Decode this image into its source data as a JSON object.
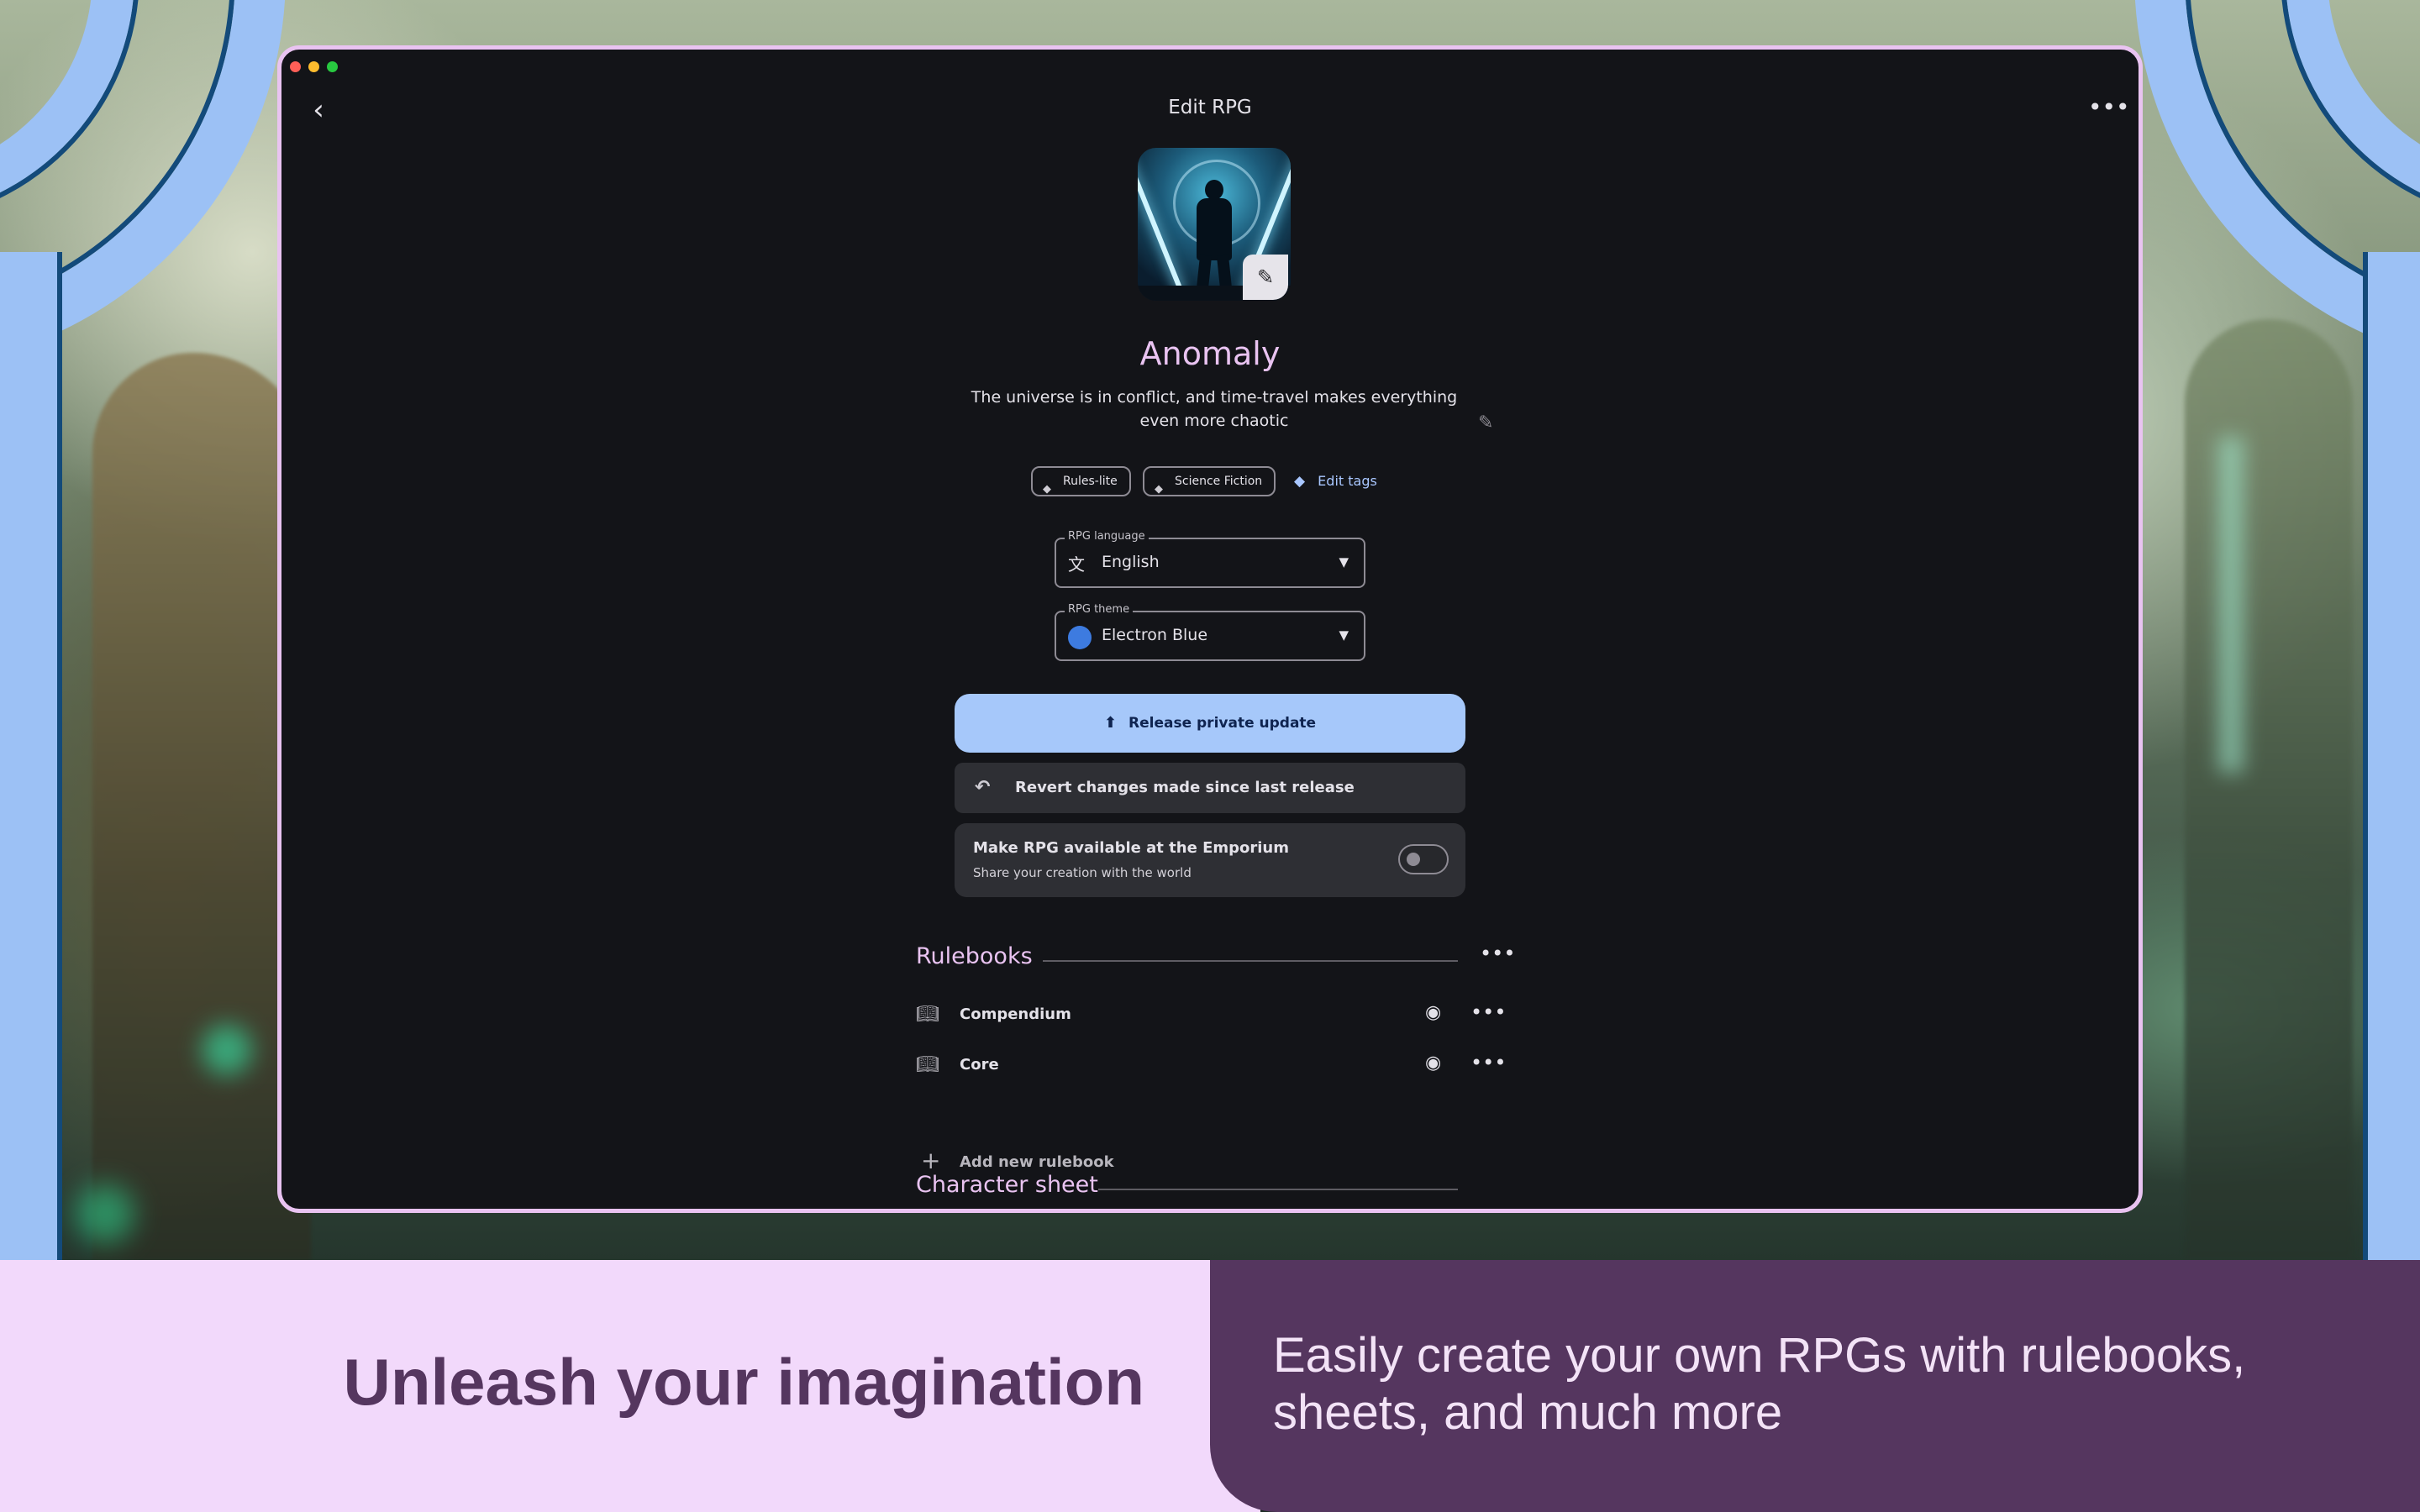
{
  "window": {
    "title": "Edit RPG",
    "back_icon": "‹",
    "more_icon": "•••"
  },
  "rpg": {
    "name": "Anomaly",
    "description": "The universe is in conflict, and time-travel makes everything even more chaotic",
    "tags": [
      "Rules-lite",
      "Science Fiction"
    ],
    "edit_tags_label": "Edit tags"
  },
  "language": {
    "label": "RPG language",
    "value": "English"
  },
  "theme": {
    "label": "RPG theme",
    "value": "Electron Blue",
    "color": "#3d7be0"
  },
  "actions": {
    "release_label": "Release private update",
    "revert_label": "Revert changes made since last release",
    "emporium_title": "Make RPG available at the Emporium",
    "emporium_subtitle": "Share your creation with the world",
    "emporium_enabled": false
  },
  "rulebooks": {
    "section_title": "Rulebooks",
    "items": [
      {
        "name": "Compendium"
      },
      {
        "name": "Core"
      }
    ],
    "add_label": "Add new rulebook"
  },
  "character_sheet": {
    "section_title": "Character sheet"
  },
  "banner": {
    "headline": "Unleash your imagination",
    "tagline": "Easily create your own RPGs with rulebooks, sheets, and much more"
  },
  "colors": {
    "accent": "#e9c3f1",
    "primary_button": "#a6c8fa",
    "banner_dark": "#55365f",
    "banner_light": "#f2d9fb",
    "frame_blue": "#9cc1f5"
  }
}
